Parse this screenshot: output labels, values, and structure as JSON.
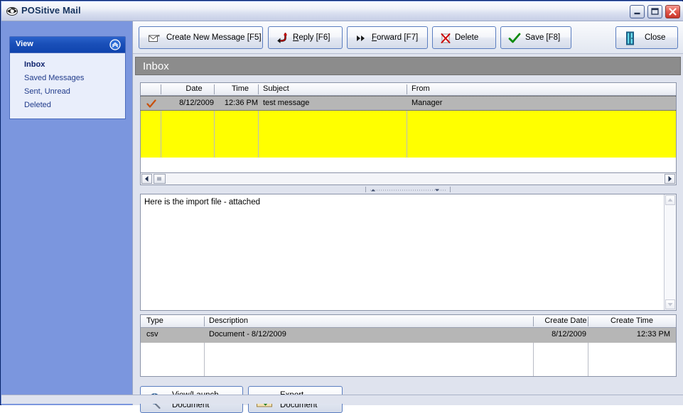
{
  "window": {
    "title": "POSitive Mail",
    "icon": "app-mail-icon",
    "controls": {
      "minimize": "Minimize",
      "maximize": "Maximize",
      "close": "Close"
    }
  },
  "sidebar": {
    "panel_title": "View",
    "collapse_icon": "chevron-up-icon",
    "items": [
      {
        "label": "Inbox",
        "active": true
      },
      {
        "label": "Saved Messages",
        "active": false
      },
      {
        "label": "Sent, Unread",
        "active": false
      },
      {
        "label": "Deleted",
        "active": false
      }
    ]
  },
  "toolbar": {
    "buttons": [
      {
        "id": "create",
        "label": "Create New Message [F5]",
        "icon": "envelope-new-icon",
        "accel": ""
      },
      {
        "id": "reply",
        "label": "Reply [F6]",
        "icon": "reply-arrow-icon",
        "accel": "R"
      },
      {
        "id": "forward",
        "label": "Forward [F7]",
        "icon": "fast-forward-icon",
        "accel": "F"
      },
      {
        "id": "delete",
        "label": "Delete",
        "icon": "delete-x-icon",
        "accel": ""
      },
      {
        "id": "save",
        "label": "Save [F8]",
        "icon": "green-check-icon",
        "accel": ""
      },
      {
        "id": "close",
        "label": "Close",
        "icon": "exit-door-icon",
        "accel": ""
      }
    ]
  },
  "section": {
    "title": "Inbox"
  },
  "message_grid": {
    "columns": [
      "",
      "Date",
      "Time",
      "Subject",
      "From"
    ],
    "rows": [
      {
        "read_flag": "checkmark-icon",
        "date": "8/12/2009",
        "time": "12:36 PM",
        "subject": "test message",
        "from": "Manager",
        "selected": true
      }
    ],
    "empty_background_color": "#ffff00",
    "selected_row_color": "#b6b6b6",
    "scroll": {
      "left_arrow": "scroll-left-icon",
      "right_arrow": "scroll-right-icon"
    }
  },
  "body": {
    "text": "Here is the import file - attached",
    "scroll": {
      "up_arrow": "scroll-up-icon",
      "down_arrow": "scroll-down-icon"
    }
  },
  "attachment_grid": {
    "columns": [
      "Type",
      "Description",
      "Create Date",
      "Create Time"
    ],
    "rows": [
      {
        "type": "csv",
        "description": "Document -  8/12/2009",
        "create_date": "8/12/2009",
        "create_time": "12:33 PM",
        "selected": true
      }
    ]
  },
  "document_actions": [
    {
      "id": "view-launch",
      "label": "View/Launch\nDocument",
      "icon": "magnifier-globe-icon"
    },
    {
      "id": "export",
      "label": "Export\nDocument",
      "icon": "folder-export-icon"
    }
  ],
  "colors": {
    "sidebar_bg": "#7b96de",
    "panel_header": "#1a4fb8",
    "section_band": "#8c8c8c",
    "grid_empty": "#ffff00",
    "selection": "#b6b6b6",
    "accent_border": "#5a7dc0"
  }
}
